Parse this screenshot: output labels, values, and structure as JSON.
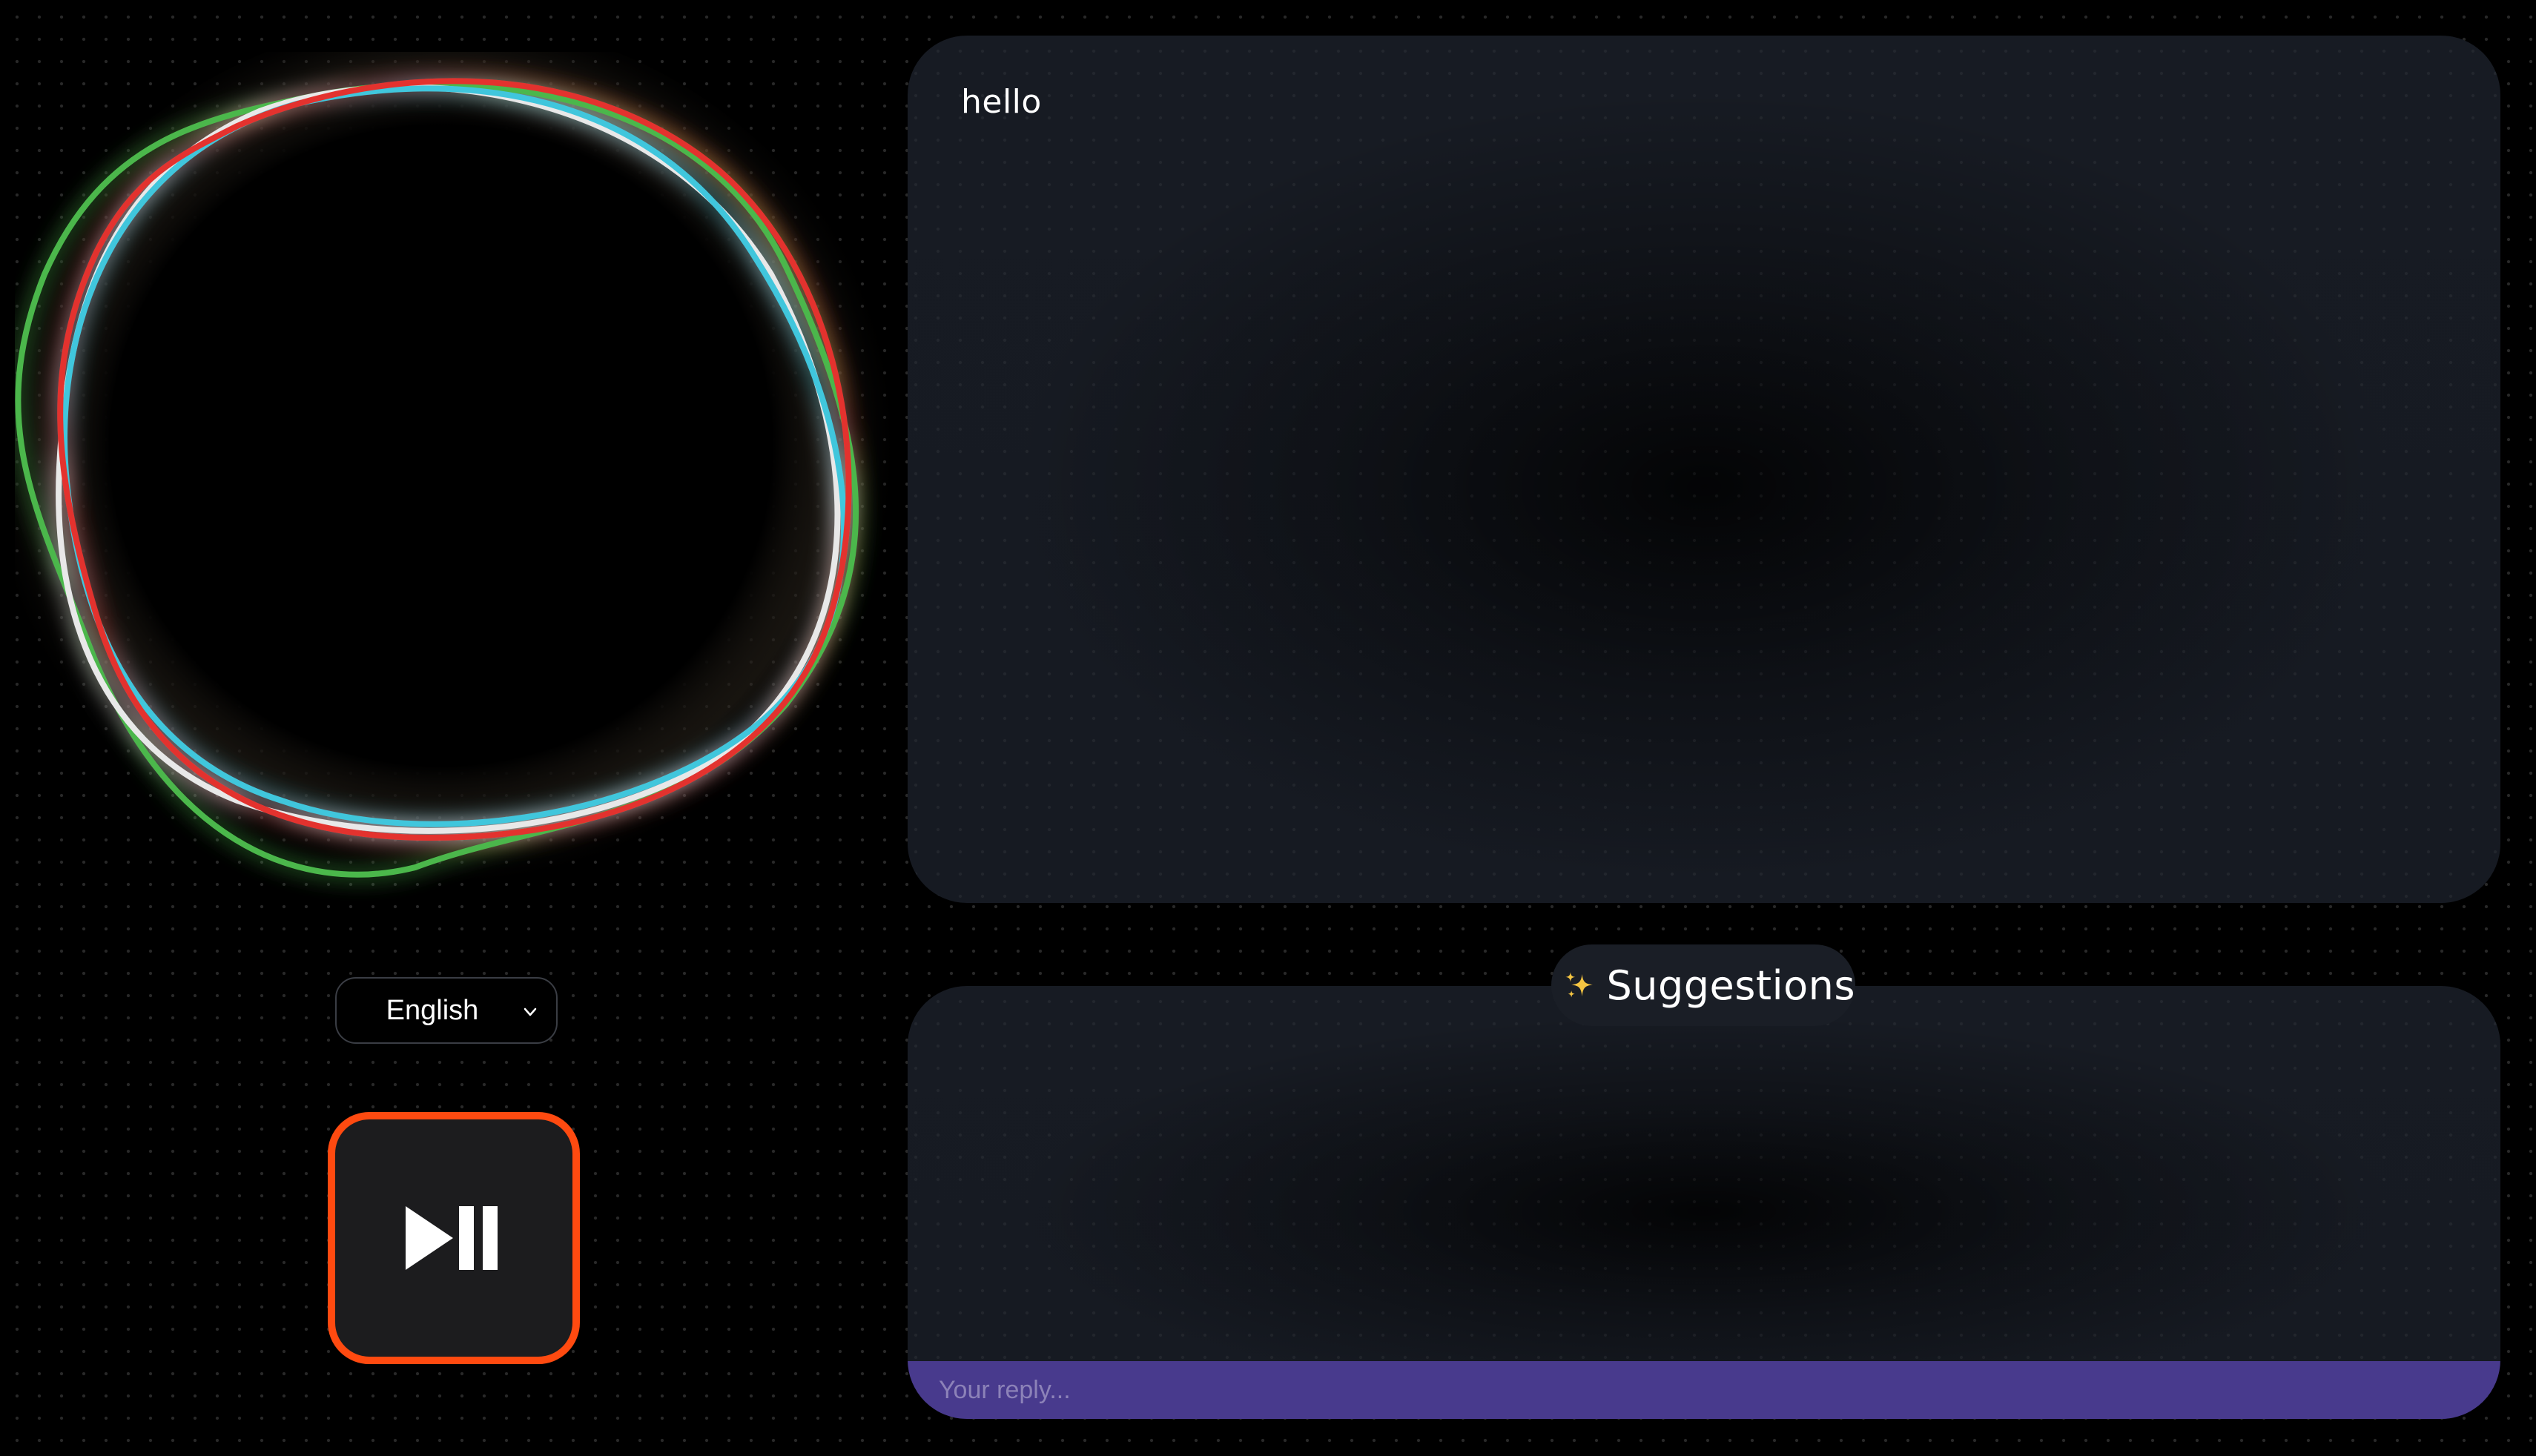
{
  "visualizer": {
    "rings": [
      {
        "color": "#4cb74c"
      },
      {
        "color": "#e8e8e8"
      },
      {
        "color": "#3fc6dc"
      },
      {
        "color": "#e3322e"
      }
    ]
  },
  "language_select": {
    "value": "English",
    "icon": "chevron-down-icon"
  },
  "play_pause_button": {
    "icon": "play-pause-icon",
    "border_color": "#ff4a10"
  },
  "transcript": {
    "text": "hello"
  },
  "suggestions": {
    "icon": "sparkles-icon",
    "label": "Suggestions"
  },
  "reply": {
    "placeholder": "Your reply...",
    "bar_color": "#483a8d"
  }
}
